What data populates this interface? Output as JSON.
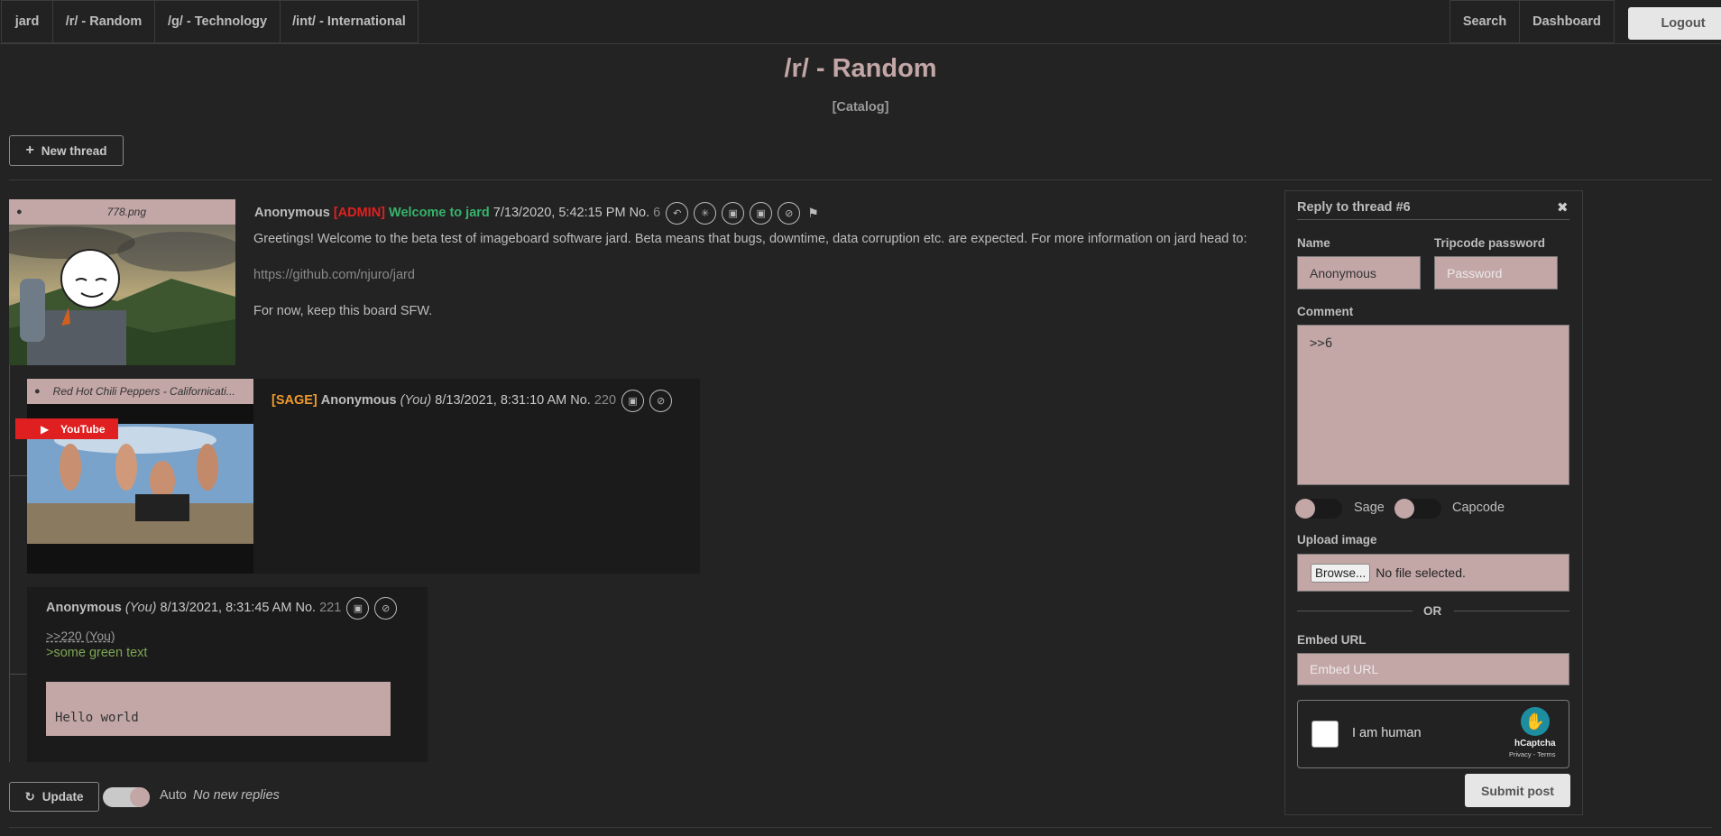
{
  "nav": {
    "items": [
      {
        "label": "jard"
      },
      {
        "label": "/r/ - Random"
      },
      {
        "label": "/g/ - Technology"
      },
      {
        "label": "/int/ - International"
      }
    ],
    "search": "Search",
    "dashboard": "Dashboard",
    "logout": "Logout"
  },
  "board": {
    "title": "/r/ - Random",
    "catalog": "[Catalog]",
    "new_thread": "New thread"
  },
  "op": {
    "filename": "778.png",
    "name": "Anonymous",
    "capcode": "[ADMIN]",
    "subject": "Welcome to jard",
    "date": "7/13/2020, 5:42:15 PM",
    "no_label": "No.",
    "no": "6",
    "body1": "Greetings! Welcome to the beta test of imageboard software jard. Beta means that bugs, downtime, data corruption etc. are expected. For more information on jard head to:",
    "link": "https://github.com/njuro/jard",
    "body2": "For now, keep this board SFW.",
    "icons": [
      "reply-icon",
      "sticky-icon",
      "lock-icon",
      "delete-icon",
      "ban-icon",
      "pin-icon"
    ]
  },
  "reply1": {
    "filename": "Red Hot Chili Peppers - Californicati...",
    "badge": "YouTube",
    "sage": "[SAGE]",
    "name": "Anonymous",
    "you": "(You)",
    "date": "8/13/2021, 8:31:10 AM",
    "no_label": "No.",
    "no": "220"
  },
  "reply2": {
    "name": "Anonymous",
    "you": "(You)",
    "date": "8/13/2021, 8:31:45 AM",
    "no_label": "No.",
    "no": "221",
    "quote": ">>220 (You)",
    "greentext": ">some green text",
    "code": "Hello world"
  },
  "footer": {
    "update": "Update",
    "auto": "Auto",
    "status": "No new replies"
  },
  "form": {
    "title": "Reply to thread #6",
    "close": "✖",
    "name_label": "Name",
    "name_value": "Anonymous",
    "trip_label": "Tripcode password",
    "trip_placeholder": "Password",
    "comment_label": "Comment",
    "comment_value": ">>6",
    "sage_label": "Sage",
    "capcode_label": "Capcode",
    "upload_label": "Upload image",
    "browse": "Browse...",
    "no_file": "No file selected.",
    "or": "OR",
    "embed_label": "Embed URL",
    "embed_placeholder": "Embed URL",
    "captcha_label": "I am human",
    "captcha_brand": "hCaptcha",
    "captcha_links": "Privacy - Terms",
    "submit": "Submit post"
  }
}
